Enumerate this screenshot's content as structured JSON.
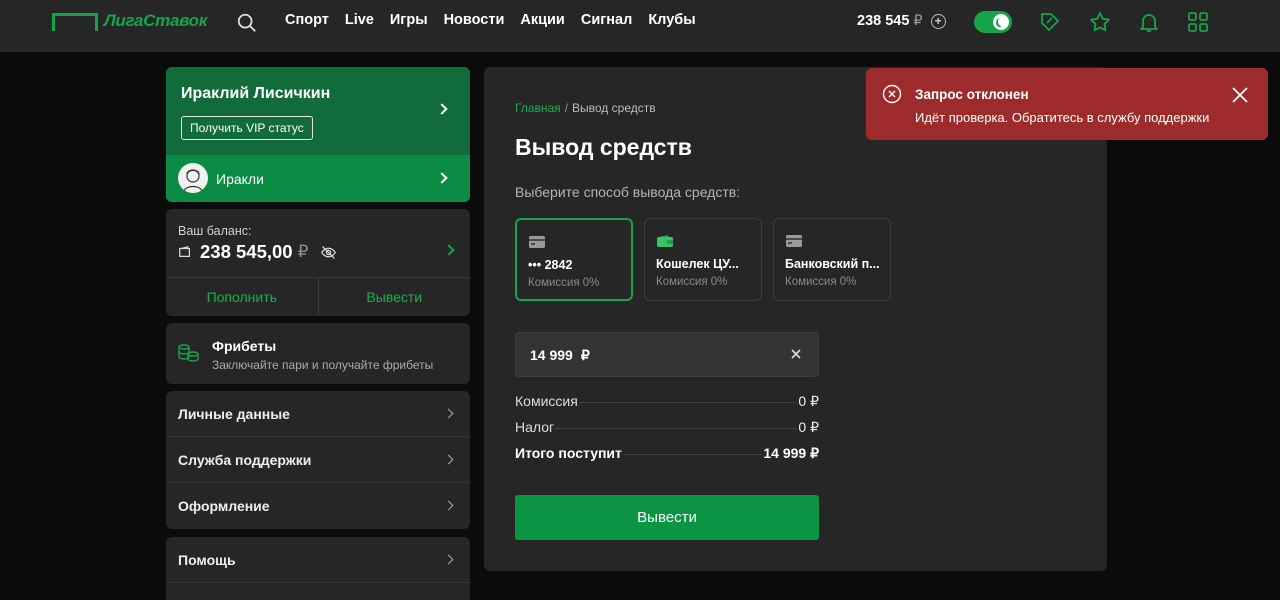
{
  "header": {
    "logo_text": "ЛигаСтавок",
    "nav": [
      "Спорт",
      "Live",
      "Игры",
      "Новости",
      "Акции",
      "Сигнал",
      "Клубы"
    ],
    "balance": "238 545",
    "balance_currency": "₽",
    "icons": [
      "search-icon",
      "plus-icon",
      "theme-toggle",
      "coupon-icon",
      "star-icon",
      "bell-icon",
      "grid-icon"
    ]
  },
  "profile": {
    "name": "Ираклий Лисичкин",
    "vip_button": "Получить VIP статус",
    "nickname": "Иракли"
  },
  "balance_card": {
    "label": "Ваш баланс:",
    "value": "238 545,00",
    "currency": "₽",
    "deposit": "Пополнить",
    "withdraw": "Вывести"
  },
  "freebets": {
    "title": "Фрибеты",
    "subtitle": "Заключайте пари и получайте фрибеты"
  },
  "menu": [
    {
      "label": "Личные данные"
    },
    {
      "label": "Служба поддержки"
    },
    {
      "label": "Оформление"
    }
  ],
  "help_menu": [
    {
      "label": "Помощь"
    }
  ],
  "main": {
    "breadcrumb_home": "Главная",
    "breadcrumb_sep": "/",
    "breadcrumb_current": "Вывод средств",
    "title": "Вывод средств",
    "choose_label": "Выберите способ вывода средств:",
    "methods": [
      {
        "title": "••• 2842",
        "fee": "Комиссия 0%",
        "icon": "card-icon",
        "selected": true
      },
      {
        "title": "Кошелек ЦУ...",
        "fee": "Комиссия 0%",
        "icon": "wallet-icon",
        "selected": false
      },
      {
        "title": "Банковский п...",
        "fee": "Комиссия 0%",
        "icon": "card-icon",
        "selected": false
      }
    ],
    "amount": "14 999",
    "amount_currency": "₽",
    "summary": [
      {
        "label": "Комиссия",
        "value": "0 ₽"
      },
      {
        "label": "Налог",
        "value": "0 ₽"
      },
      {
        "label": "Итого поступит",
        "value": "14 999 ₽"
      }
    ],
    "submit": "Вывести"
  },
  "toast": {
    "title": "Запрос отклонен",
    "message": "Идёт проверка. Обратитесь в службу поддержки"
  },
  "colors": {
    "accent": "#16a34a",
    "toast_bg": "#9e2b2b",
    "panel": "#262626"
  }
}
